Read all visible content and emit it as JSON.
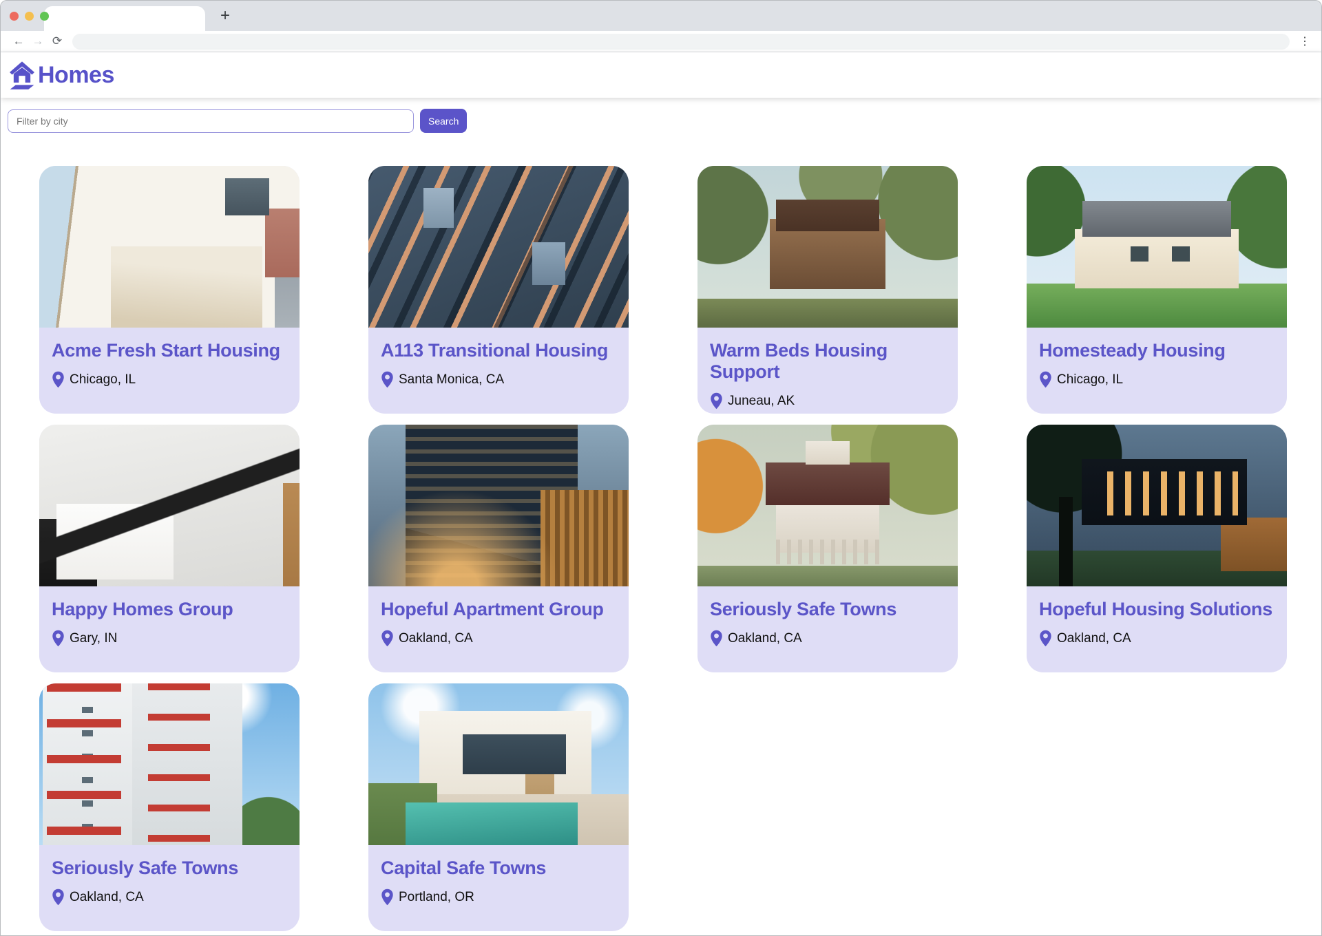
{
  "theme": {
    "primary": "#605DC8",
    "card_background": "#DFDDF6",
    "tabstrip_background": "#DEE1E6"
  },
  "browser": {
    "window_controls": {
      "close_color": "#ED6A5E",
      "minimize_color": "#F4BF4F",
      "zoom_color": "#61C554"
    },
    "tab_title": "",
    "new_tab_glyph": "+",
    "back_glyph": "←",
    "forward_glyph": "→",
    "reload_glyph": "⟳",
    "menu_glyph": "⋮",
    "address_value": ""
  },
  "app": {
    "title": "Homes"
  },
  "search": {
    "placeholder": "Filter by city",
    "button_label": "Search"
  },
  "listings": [
    {
      "name": "Acme Fresh Start Housing",
      "city": "Chicago, IL",
      "photo": "white-modern-apartment"
    },
    {
      "name": "A113 Transitional Housing",
      "city": "Santa Monica, CA",
      "photo": "navy-balcony-building"
    },
    {
      "name": "Warm Beds Housing Support",
      "city": "Juneau, AK",
      "photo": "victorian-brown-house"
    },
    {
      "name": "Homesteady Housing",
      "city": "Chicago, IL",
      "photo": "white-cottage-lawn"
    },
    {
      "name": "Happy Homes Group",
      "city": "Gary, IN",
      "photo": "bw-geometric-houses"
    },
    {
      "name": "Hopeful Apartment Group",
      "city": "Oakland, CA",
      "photo": "dusk-dark-tower"
    },
    {
      "name": "Seriously Safe Towns",
      "city": "Oakland, CA",
      "photo": "autumn-porch-house"
    },
    {
      "name": "Hopeful Housing Solutions",
      "city": "Oakland, CA",
      "photo": "night-modern-house"
    },
    {
      "name": "Seriously Safe Towns",
      "city": "Oakland, CA",
      "photo": "red-white-towers"
    },
    {
      "name": "Capital Safe Towns",
      "city": "Portland, OR",
      "photo": "villa-with-pool"
    }
  ]
}
